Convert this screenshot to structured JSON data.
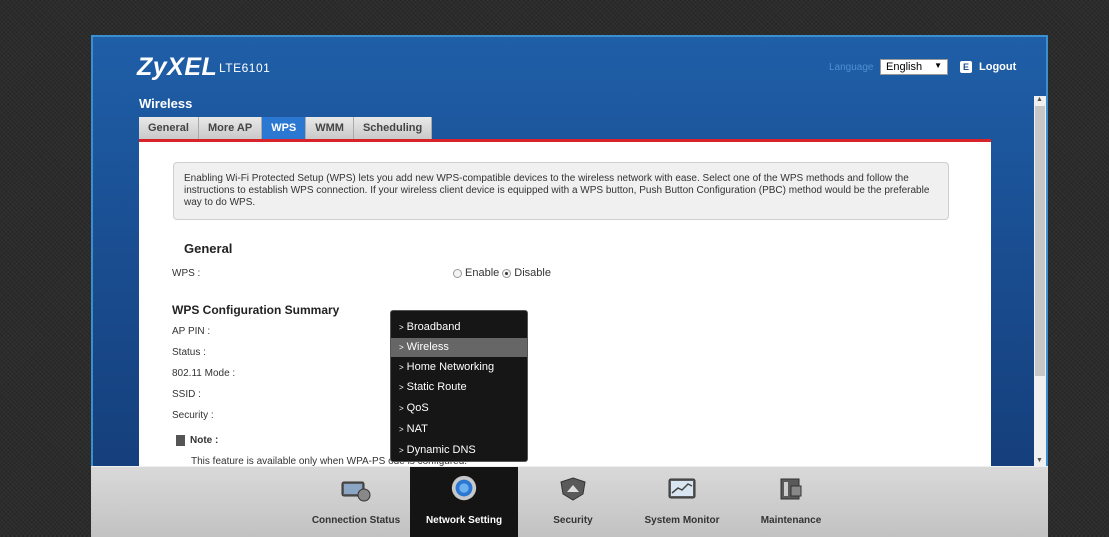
{
  "header": {
    "logo": "ZyXEL",
    "model": "LTE6101",
    "language_label": "Language",
    "language_value": "English",
    "logout_label": "Logout"
  },
  "page": {
    "title": "Wireless",
    "tabs": [
      "General",
      "More AP",
      "WPS",
      "WMM",
      "Scheduling"
    ],
    "active_tab": "WPS"
  },
  "info_text": "Enabling Wi-Fi Protected Setup (WPS) lets you add new WPS-compatible devices to the wireless network with ease. Select one of the WPS methods and follow the instructions to establish WPS connection. If your wireless client device is equipped with a WPS button, Push Button Configuration (PBC) method would be the preferable way to do WPS.",
  "general": {
    "heading": "General",
    "wps_label": "WPS :",
    "enable_label": "Enable",
    "disable_label": "Disable",
    "selected": "Disable"
  },
  "summary": {
    "heading": "WPS Configuration Summary",
    "ap_pin": "AP PIN :",
    "status": "Status :",
    "mode": "802.11 Mode :",
    "ssid": "SSID :",
    "security": "Security :"
  },
  "note": {
    "label": "Note :",
    "text": "This feature is available only when WPA-PS                                    ode is configured."
  },
  "menu": {
    "items": [
      "Broadband",
      "Wireless",
      "Home Networking",
      "Static Route",
      "QoS",
      "NAT",
      "Dynamic DNS"
    ],
    "selected": "Wireless"
  },
  "dock": {
    "items": [
      "Connection Status",
      "Network Setting",
      "Security",
      "System Monitor",
      "Maintenance"
    ],
    "active": "Network Setting"
  },
  "colors": {
    "accent": "#2a78d2",
    "tab_underline": "#d8232a",
    "header_bg": "#1a4f93"
  }
}
